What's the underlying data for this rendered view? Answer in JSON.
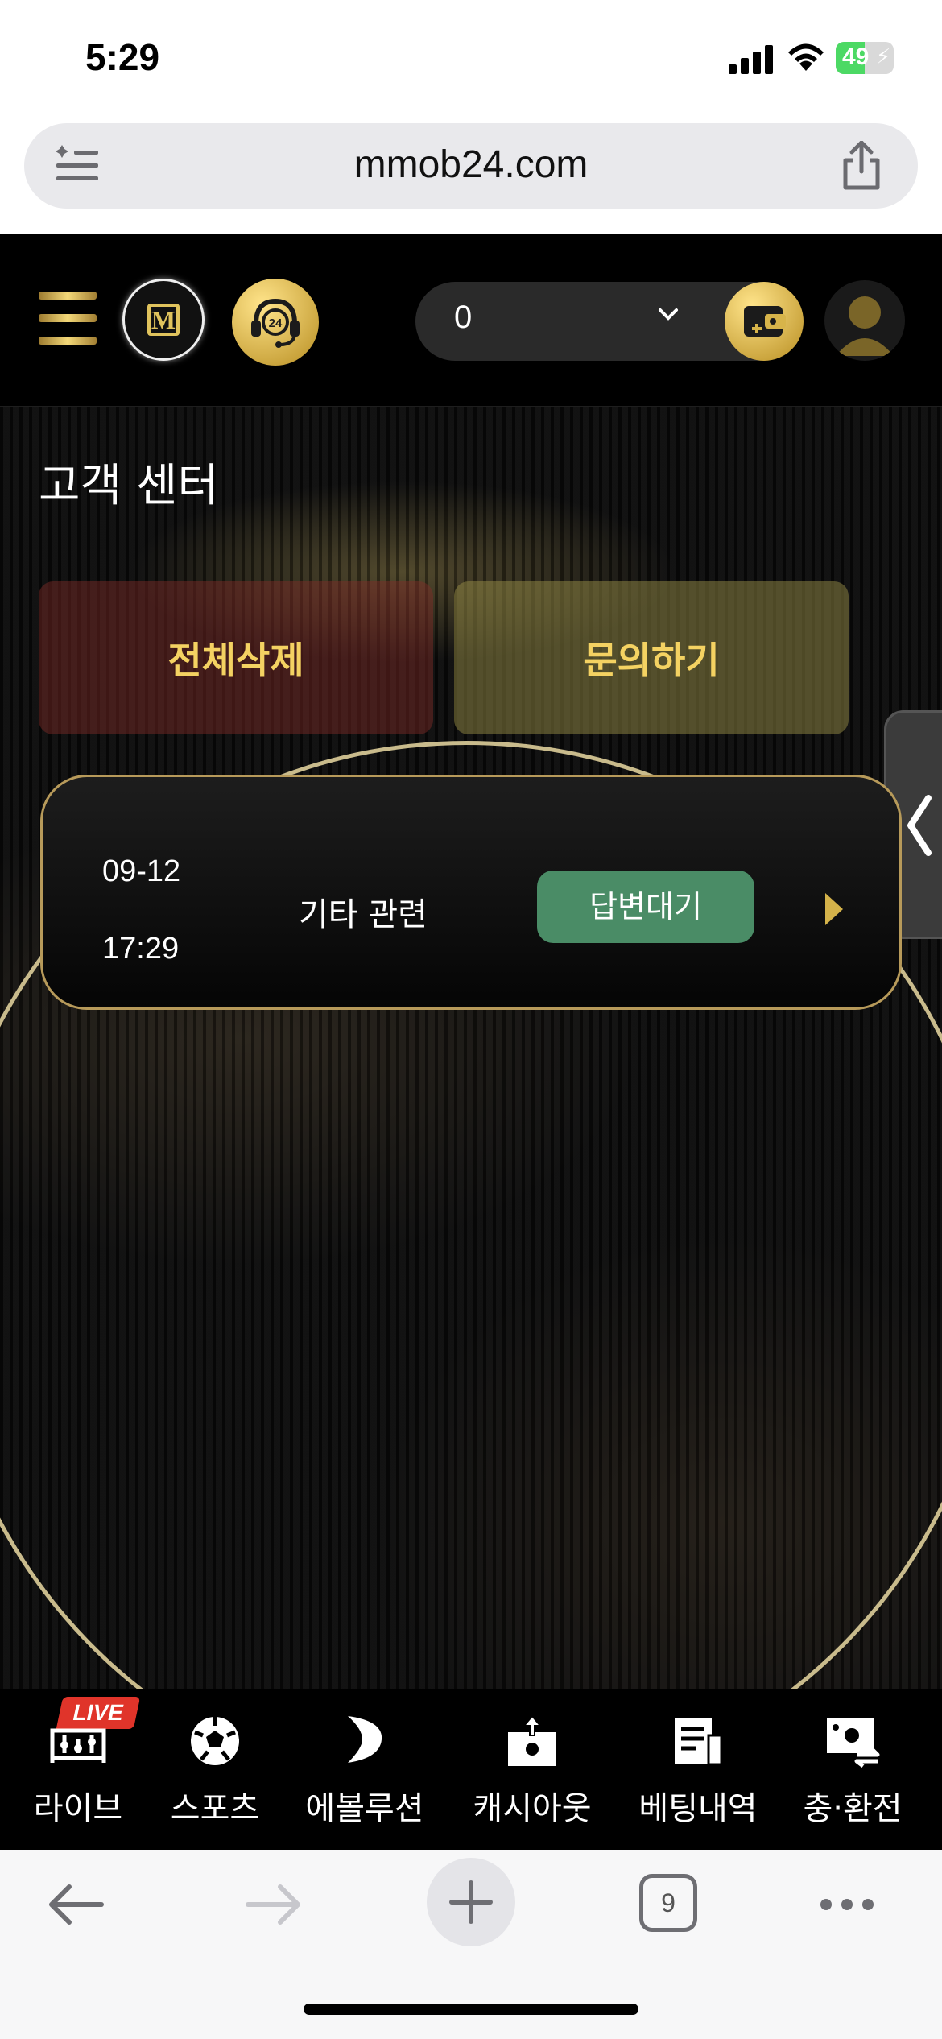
{
  "status_bar": {
    "time": "5:29",
    "battery": "49"
  },
  "browser": {
    "url": "mmob24.com",
    "tab_count": "9"
  },
  "header": {
    "balance": "0",
    "icons": [
      "menu-icon",
      "logo-icon",
      "support-24-icon",
      "chevron-down-icon",
      "wallet-icon",
      "user-avatar-icon"
    ]
  },
  "page": {
    "title": "고객 센터",
    "delete_all_label": "전체삭제",
    "inquire_label": "문의하기"
  },
  "inquiries": [
    {
      "date": "09-12",
      "time": "17:29",
      "category": "기타 관련",
      "status": "답변대기"
    }
  ],
  "bottom_nav": {
    "live_badge": "LIVE",
    "items": [
      {
        "label": "라이브",
        "icon": "live-stats-icon"
      },
      {
        "label": "스포츠",
        "icon": "soccer-ball-icon"
      },
      {
        "label": "에볼루션",
        "icon": "evolution-icon"
      },
      {
        "label": "캐시아웃",
        "icon": "cashout-icon"
      },
      {
        "label": "베팅내역",
        "icon": "betting-history-icon"
      },
      {
        "label": "충·환전",
        "icon": "exchange-icon"
      }
    ]
  },
  "colors": {
    "gold": "#f4d262",
    "status_green": "#4a8c66",
    "live_red": "#e0342a",
    "background": "#0b0b0b"
  }
}
